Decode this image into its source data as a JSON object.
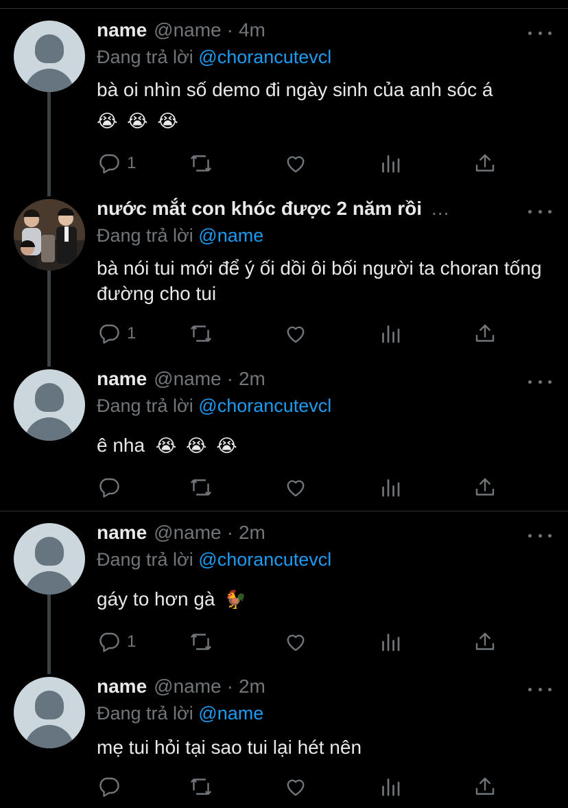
{
  "tweets": [
    {
      "display_name": "name",
      "handle": "@name",
      "time": "4m",
      "reply_prefix": "Đang trả lời",
      "reply_to": "@chorancutevcl",
      "text": "bà oi nhìn số demo đi ngày sinh của anh sóc á",
      "emojis": [
        "😭",
        "😭",
        "😭"
      ],
      "reply_count": "1",
      "avatar": "default"
    },
    {
      "display_name": "nước mắt con khóc được 2 năm rồi",
      "handle": "",
      "time": "",
      "truncation": "...",
      "reply_prefix": "Đang trả lời",
      "reply_to": "@name",
      "text": "bà nói tui mới để ý ối dồi ôi bối người ta choran tống đường cho tui",
      "reply_count": "1",
      "avatar": "photo"
    },
    {
      "display_name": "name",
      "handle": "@name",
      "time": "2m",
      "reply_prefix": "Đang trả lời",
      "reply_to": "@chorancutevcl",
      "text": "ê nha",
      "emojis": [
        "😭",
        "😭",
        "😭"
      ],
      "reply_count": "",
      "avatar": "default"
    },
    {
      "display_name": "name",
      "handle": "@name",
      "time": "2m",
      "reply_prefix": "Đang trả lời",
      "reply_to": "@chorancutevcl",
      "text": "gáy to hơn gà",
      "emojis": [
        "🐓"
      ],
      "reply_count": "1",
      "avatar": "default"
    },
    {
      "display_name": "name",
      "handle": "@name",
      "time": "2m",
      "reply_prefix": "Đang trả lời",
      "reply_to": "@name",
      "text": "mẹ tui hỏi tại sao tui lại hét nên",
      "reply_count": "",
      "avatar": "default"
    }
  ],
  "separator": "·",
  "icons": {
    "reply": "reply-icon",
    "retweet": "retweet-icon",
    "like": "like-icon",
    "analytics": "analytics-icon",
    "share": "share-icon",
    "more": "more-icon"
  },
  "colors": {
    "background": "#000000",
    "text": "#e7e9ea",
    "muted": "#71767b",
    "mention": "#1d9bf0",
    "thread_line": "#3d4247"
  }
}
